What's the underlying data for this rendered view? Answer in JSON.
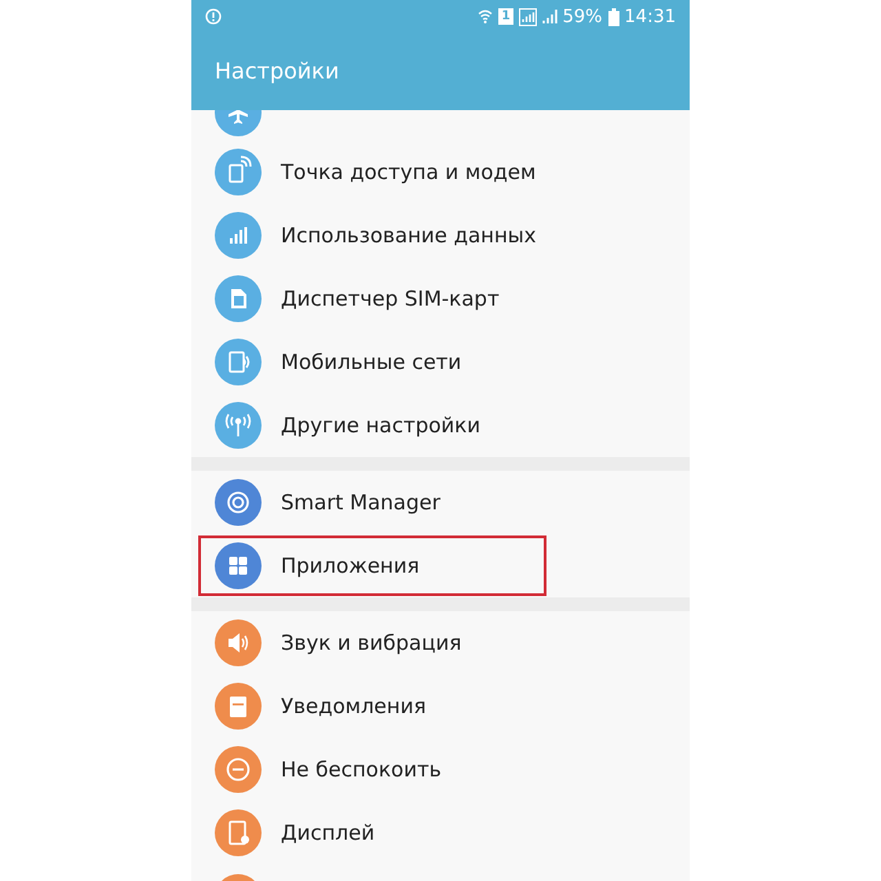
{
  "status_bar": {
    "battery": "59%",
    "time": "14:31",
    "sim": "1"
  },
  "app_bar": {
    "title": "Настройки"
  },
  "groups": [
    {
      "items": [
        {
          "label": "Точка доступа и модем",
          "color": "#5aafe2",
          "highlighted": false
        },
        {
          "label": "Использование данных",
          "color": "#5aafe2",
          "highlighted": false
        },
        {
          "label": "Диспетчер SIM-карт",
          "color": "#5aafe2",
          "highlighted": false
        },
        {
          "label": "Мобильные сети",
          "color": "#5aafe2",
          "highlighted": false
        },
        {
          "label": "Другие настройки",
          "color": "#5aafe2",
          "highlighted": false
        }
      ]
    },
    {
      "items": [
        {
          "label": "Smart Manager",
          "color": "#4f86d6",
          "highlighted": false
        },
        {
          "label": "Приложения",
          "color": "#4f86d6",
          "highlighted": true
        }
      ]
    },
    {
      "items": [
        {
          "label": "Звук и вибрация",
          "color": "#ef8c4c",
          "highlighted": false
        },
        {
          "label": "Уведомления",
          "color": "#ef8c4c",
          "highlighted": false
        },
        {
          "label": "Не беспокоить",
          "color": "#ef8c4c",
          "highlighted": false
        },
        {
          "label": "Дисплей",
          "color": "#ef8c4c",
          "highlighted": false
        }
      ]
    }
  ]
}
